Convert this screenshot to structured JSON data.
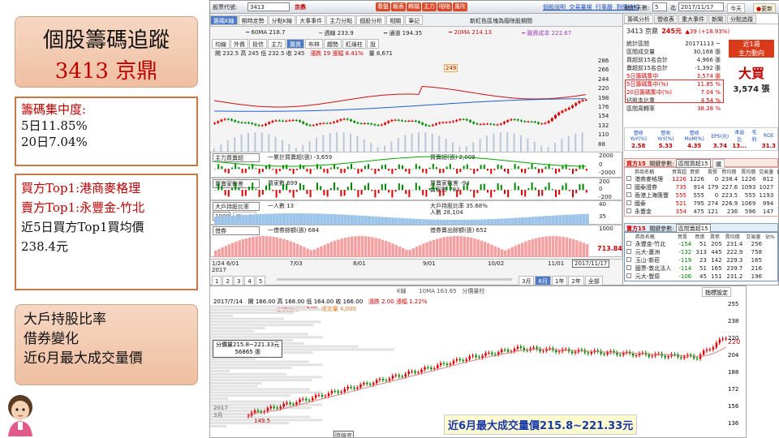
{
  "title": {
    "line1": "個股籌碼追蹤",
    "line2": "3413 京鼎"
  },
  "concentration": {
    "label": "籌碼集中度:",
    "d5": "5日11.85%",
    "d20": "20日7.04%"
  },
  "buyer": {
    "top_buyer": "買方Top1:港商麥格理",
    "top_seller": "賣方Top1:永豐金-竹北",
    "avg_price_label": "近5日買方Top1買均價",
    "avg_price": "238.4元"
  },
  "topics": [
    "大戶持股比率",
    "借券變化",
    "近6月最大成交量價"
  ],
  "app": {
    "toolbar": {
      "code_label": "股票代號:",
      "code": "3413",
      "name": "京鼎",
      "red_buttons": [
        "看盤",
        "報表",
        "轉檔",
        "主力",
        "啪啪",
        "風吹"
      ],
      "links": [
        "個股說明",
        "交易量規",
        "行事曆",
        "到價通知"
      ]
    },
    "main_tabs": [
      "籌碼K線",
      "期時走勢",
      "分點K線",
      "大事事件",
      "主力分點",
      "個股分析",
      "相關",
      "筆記"
    ],
    "header_note": "新紅色區塊為廢除股期間",
    "legend_ma": [
      {
        "label": "60MA 218.7",
        "color": "#2060d0"
      },
      {
        "label": "週線 233.9",
        "color": "#888888"
      },
      {
        "label": "通道 194.35",
        "color": "#444444"
      },
      {
        "label": "20MA 214.13",
        "color": "#d01010"
      },
      {
        "label": "融資成本 222.67",
        "color": "#a040c0"
      }
    ],
    "ktools": [
      "均線",
      "外資",
      "投信",
      "主力",
      "籌資",
      "布林",
      "趨勢",
      "紅綠柱",
      "設"
    ],
    "ohlc": "開 232.5  高 245  低 232.5  收 245",
    "change": "漲跌 19  漲幅 8.41%",
    "volume": "量 8,671",
    "peak_label": "249",
    "main_yticks": [
      "286",
      "266",
      "244",
      "220",
      "198",
      "176",
      "154",
      "132",
      "110",
      "88"
    ],
    "panels": [
      {
        "name": "主力買賣超",
        "items": [
          "一累計買賣超(張) -3,659",
          "買賣超(張) 2,009"
        ],
        "yticks": [
          "2000",
          "0",
          "-2000"
        ]
      },
      {
        "name": "買賣家數差",
        "items": [
          "買家數 699",
          "賣家數 793",
          "買賣家數差 -94"
        ],
        "yticks": [
          "200",
          "0",
          "-200"
        ]
      },
      {
        "name": "大戶持股比率",
        "items": [
          "一人數 13",
          "人數 28,104",
          "大戶持股比率 35.68%"
        ],
        "yticks": [
          "40",
          "35"
        ],
        "select": "1000",
        "select2": "張以上"
      },
      {
        "name": "借券",
        "items": [
          "一借券餘額(張) 684",
          "借券賣出餘額(張) 652"
        ],
        "yticks": [
          "1000"
        ],
        "last_value": "713.84"
      }
    ],
    "x_dates": [
      "1/24 6/01",
      "7/03",
      "8/01",
      "9/01",
      "10/02",
      "11/01"
    ],
    "x_year": "2017",
    "current_date": "2017/11/17",
    "pages": [
      "1",
      "2",
      "3",
      "4",
      "5"
    ],
    "periods": [
      "3月",
      "6月",
      "1年",
      "2年",
      "全部",
      "群據"
    ]
  },
  "right": {
    "days_label": "統計天數:",
    "days": "5",
    "end_label": "迄",
    "end_date": "2017/11/17",
    "today_btn": "今天",
    "refresh_btn": "更新",
    "tabs": [
      "籌碼分析",
      "營收表",
      "重大事件",
      "新聞",
      "分點追蹤"
    ],
    "stock": "3413  京鼎",
    "price": "245元",
    "price_change": "▲39 (+18.93%)",
    "stats": [
      {
        "k": "統計區間",
        "v": "20171113 ~"
      },
      {
        "k": "區間成交量",
        "v": "30,168 張"
      },
      {
        "k": "買超前15名合計",
        "v": "4,966 張"
      },
      {
        "k": "賣超前15名合計",
        "v": "-1,392 張"
      },
      {
        "k": "5日籌碼集中",
        "v": "3,574 張"
      },
      {
        "k": "5日籌碼集中(%)",
        "v": "11.85 %"
      },
      {
        "k": "20日籌碼集中(%)",
        "v": "7.04 %"
      },
      {
        "k": "佔股本比重",
        "v": "4.54 %"
      },
      {
        "k": "區間周轉率",
        "v": "38.28 %"
      }
    ],
    "badge": {
      "l1": "近1週",
      "l2": "主力動向"
    },
    "verdict": "大買",
    "verdict_amount": "3,574 張",
    "metrics_head": [
      "營收YoY(%)",
      "營收YoY(%)",
      "營收MoM(%)",
      "EPS(元)",
      "本益比",
      "毛利",
      "ROE"
    ],
    "metrics_vals": [
      "2.58",
      "5.33",
      "4.35",
      "3.74",
      "13...",
      "",
      "31.3"
    ],
    "buy_head": {
      "title": "買方15",
      "filter_label": "關鍵參數:",
      "filter": "區間買超15",
      "btn": "購"
    },
    "buy_cols": [
      "券商名稱",
      "買賣超",
      "買張",
      "賣張",
      "買均價",
      "賣均價",
      "交易量",
      "佔%"
    ],
    "buy_rows": [
      {
        "name": "港商麥格理",
        "net": "1226",
        "b": "1226",
        "s": "0",
        "bp": "238.4",
        "sp": "1226",
        "vol": "812"
      },
      {
        "name": "國泰證券",
        "net": "735",
        "b": "914",
        "s": "179",
        "bp": "227.6",
        "sp": "1093",
        "vol": "1027"
      },
      {
        "name": "香港上海匯豐",
        "net": "555",
        "b": "555",
        "s": "0",
        "bp": "223.5",
        "sp": "555",
        "vol": "1193"
      },
      {
        "name": "國泰",
        "net": "521",
        "b": "795",
        "s": "274",
        "bp": "226.9",
        "sp": "1069",
        "vol": "994"
      },
      {
        "name": "永豐金",
        "net": "354",
        "b": "475",
        "s": "121",
        "bp": "236",
        "sp": "596",
        "vol": "147"
      }
    ],
    "sell_head": {
      "title": "賣方15",
      "filter_label": "關鍵參數:",
      "filter": "區間賣超15"
    },
    "sell_cols": [
      "券商名稱",
      "買賣",
      "買張",
      "賣張",
      "賣均價",
      "交易量",
      "佔%"
    ],
    "sell_rows": [
      {
        "name": "永豐金-竹北",
        "net": "-154",
        "b": "51",
        "s": "205",
        "sp": "231.4",
        "vol": "256"
      },
      {
        "name": "元大-蘆洲",
        "net": "-132",
        "b": "313",
        "s": "445",
        "sp": "222.9",
        "vol": "758"
      },
      {
        "name": "玉山-新莊",
        "net": "-119",
        "b": "23",
        "s": "142",
        "sp": "229.3",
        "vol": "165"
      },
      {
        "name": "國票-敦北法人",
        "net": "-114",
        "b": "51",
        "s": "165",
        "sp": "239.7",
        "vol": "216"
      },
      {
        "name": "元大-豐原",
        "net": "-106",
        "b": "45",
        "s": "151",
        "sp": "231.2",
        "vol": "196"
      }
    ]
  },
  "lower": {
    "legend": [
      "K線",
      "10MA 163.65",
      "分價量柱"
    ],
    "button": "指標設定",
    "date": "2017/7/14",
    "ohlc": "開 166.00  高 168.00  低 164.00  收 166.00",
    "change": "漲跌 2.00  漲幅 1.22%",
    "sub1": "股價波段 0.500",
    "sub2": "成交量 4,000",
    "box_l1": "分價量215.8~221.33元",
    "box_l2": "56865 張",
    "low_label": "149.5",
    "price_right": "220",
    "yticks": [
      "255",
      "238",
      "220",
      "204",
      "188",
      "172",
      "156",
      "136"
    ],
    "x_label": "2017",
    "x_label2": "3月",
    "x_label3": "時線底",
    "callout": "近6月最大成交量價215.8~221.33元"
  }
}
